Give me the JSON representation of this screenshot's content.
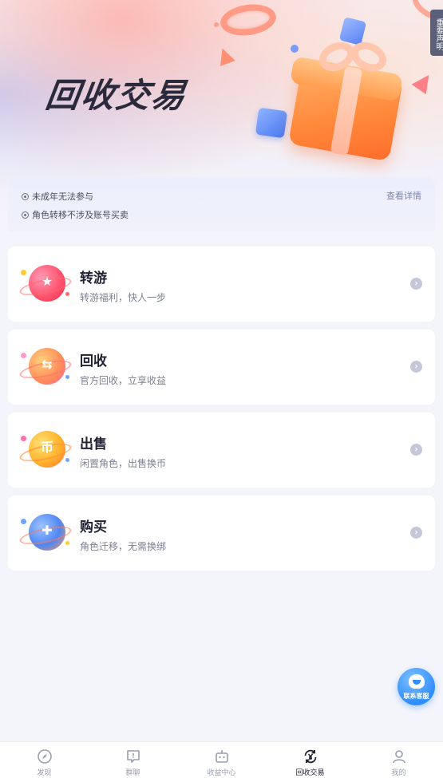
{
  "banner": {
    "title": "回收交易",
    "side_tag": "重要声明"
  },
  "notice": {
    "lines": [
      "未成年无法参与",
      "角色转移不涉及账号买卖"
    ],
    "link": "查看详情"
  },
  "cards": [
    {
      "title": "转游",
      "subtitle": "转游福利，快人一步",
      "icon": "star-planet-icon",
      "glyph": "★"
    },
    {
      "title": "回收",
      "subtitle": "官方回收，立享收益",
      "icon": "ticket-planet-icon",
      "glyph": "⇆"
    },
    {
      "title": "出售",
      "subtitle": "闲置角色，出售换币",
      "icon": "coin-planet-icon",
      "glyph": "币"
    },
    {
      "title": "购买",
      "subtitle": "角色迁移，无需换绑",
      "icon": "gamepad-planet-icon",
      "glyph": "✚"
    }
  ],
  "service": {
    "label": "联系客服"
  },
  "tabbar": {
    "items": [
      {
        "label": "发现",
        "icon": "compass-icon",
        "active": false
      },
      {
        "label": "群聊",
        "icon": "chat-icon",
        "active": false
      },
      {
        "label": "收益中心",
        "icon": "robot-icon",
        "active": false
      },
      {
        "label": "回收交易",
        "icon": "yen-recycle-icon",
        "active": true
      },
      {
        "label": "我的",
        "icon": "user-icon",
        "active": false
      }
    ]
  },
  "colors": {
    "background": "#f4f5fa",
    "card": "#ffffff",
    "accent_blue": "#2f8dff",
    "gift_orange": "#ff8a3c",
    "active_tab": "#1d1f2b",
    "inactive_tab": "#9a9dab"
  }
}
